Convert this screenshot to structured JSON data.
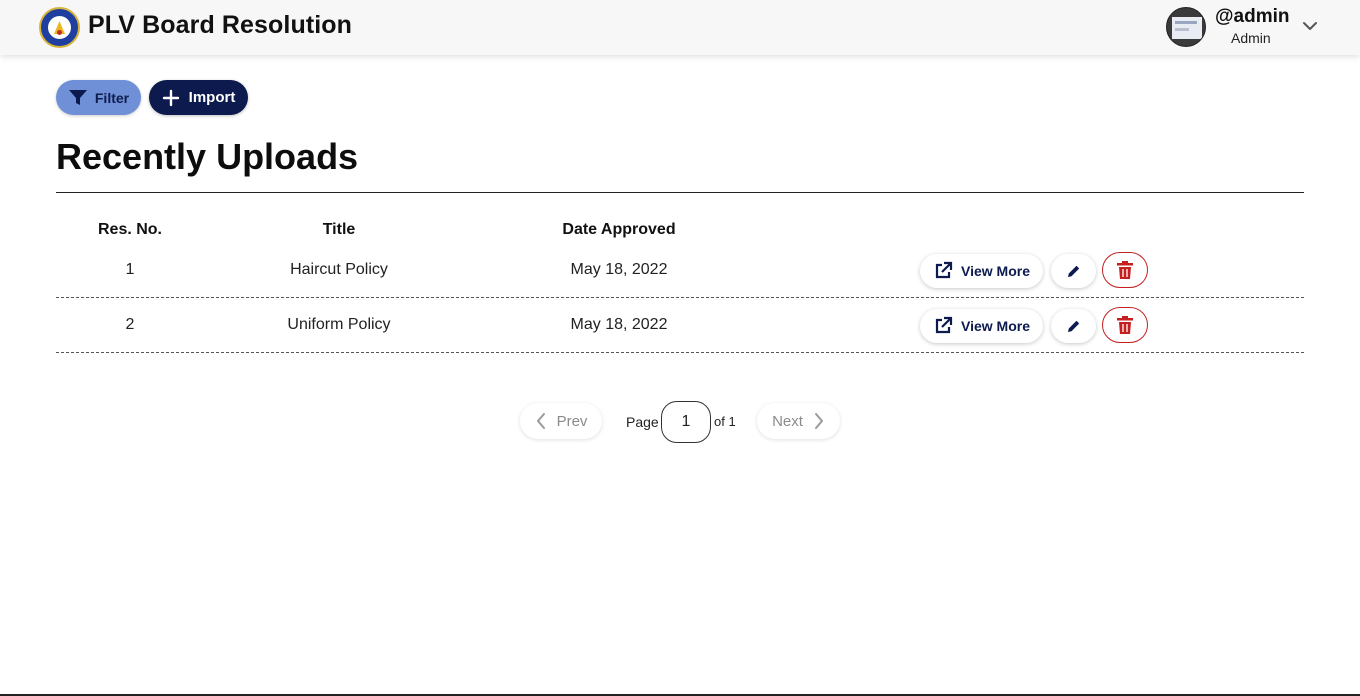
{
  "app": {
    "title": "PLV Board Resolution"
  },
  "user": {
    "name": "@admin",
    "role": "Admin"
  },
  "toolbar": {
    "filter_label": "Filter",
    "import_label": "Import"
  },
  "main": {
    "section_title": "Recently Uploads",
    "columns": [
      "Res. No.",
      "Title",
      "Date Approved"
    ],
    "rows": [
      {
        "res_no": "1",
        "title": "Haircut Policy",
        "date": "May 18, 2022"
      },
      {
        "res_no": "2",
        "title": "Uniform Policy",
        "date": "May 18, 2022"
      }
    ],
    "view_more_label": "View More"
  },
  "pagination": {
    "prev_label": "Prev",
    "page_label": "Page",
    "current_page": "1",
    "of_label": "of 1",
    "next_label": "Next"
  },
  "colors": {
    "navy": "#0c1a4e",
    "filter_blue": "#6f8fd6",
    "danger_red": "#c51f1f"
  },
  "icons": {
    "filter": "funnel-icon",
    "import": "plus-icon",
    "view_more": "external-link-icon",
    "edit": "pencil-icon",
    "delete": "trash-icon",
    "prev": "chevron-left-icon",
    "next": "chevron-right-icon",
    "user_menu": "chevron-down-icon"
  }
}
